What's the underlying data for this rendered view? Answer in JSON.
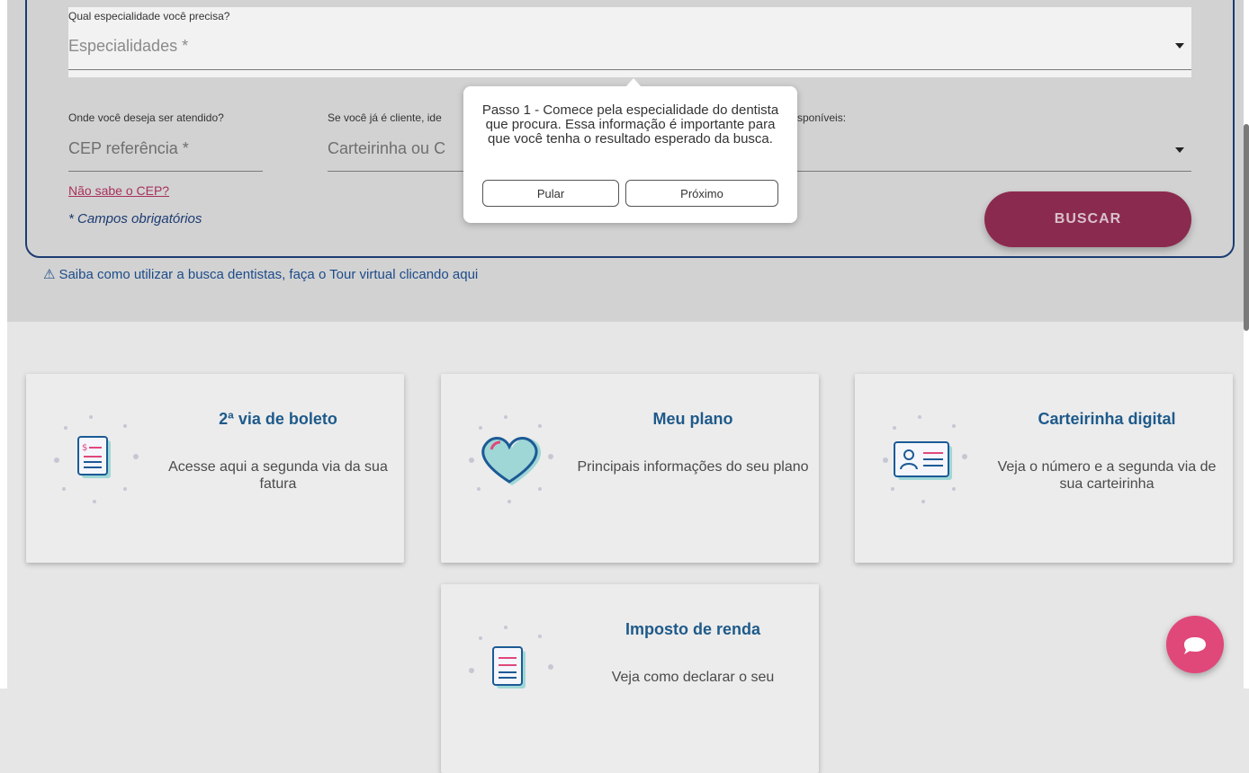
{
  "search": {
    "specialty_label": "Qual especialidade você precisa?",
    "specialty_placeholder": "Especialidades *",
    "cep_label": "Onde você deseja ser atendido?",
    "cep_placeholder": "CEP referência *",
    "client_label": "Se você já é cliente, ide",
    "client_label_tail": "sponíveis:",
    "client_placeholder": "Carteirinha ou C",
    "cep_help": "Não sabe o CEP?",
    "required_note": "* Campos obrigatórios",
    "search_button": "BUSCAR"
  },
  "tour": {
    "warning_symbol": "⚠",
    "text": "Saiba como utilizar a busca dentistas, faça o Tour virtual clicando aqui"
  },
  "tooltip": {
    "text": "Passo 1 - Comece pela especialidade do dentista que procura. Essa informação é importante para que você tenha o resultado esperado da busca.",
    "skip": "Pular",
    "next": "Próximo"
  },
  "cards": [
    {
      "title": "2ª via de boleto",
      "desc": "Acesse aqui a segunda via da sua fatura",
      "icon": "invoice-icon"
    },
    {
      "title": "Meu plano",
      "desc": "Principais informações do seu plano",
      "icon": "heart-icon"
    },
    {
      "title": "Carteirinha digital",
      "desc": "Veja o número e a segunda via de sua carteirinha",
      "icon": "id-card-icon"
    },
    {
      "title": "Imposto de renda",
      "desc": "Veja como declarar o seu",
      "icon": "document-icon"
    }
  ],
  "colors": {
    "brand_blue": "#1c3c72",
    "accent_magenta": "#8b2a4f",
    "card_title": "#1e5a8a",
    "chat_pink": "#e0487a"
  }
}
